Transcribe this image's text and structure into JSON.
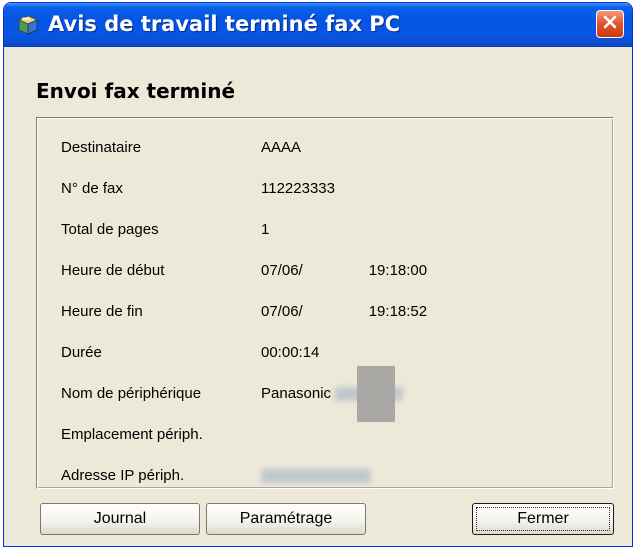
{
  "window": {
    "title": "Avis de travail terminé fax PC",
    "icon": "fax-app-icon",
    "close_icon": "close-icon"
  },
  "heading": "Envoi fax terminé",
  "details": [
    {
      "label": "Destinataire",
      "value": "AAAA"
    },
    {
      "label": "N° de fax",
      "value": "112223333"
    },
    {
      "label": "Total de pages",
      "value": "1"
    },
    {
      "label": "Heure de début",
      "value_prefix": "07/06/",
      "value_suffix": "19:18:00"
    },
    {
      "label": "Heure de fin",
      "value_prefix": "07/06/",
      "value_suffix": "19:18:52"
    },
    {
      "label": "Durée",
      "value": "00:00:14"
    },
    {
      "label": "Nom de périphérique",
      "value": "Panasonic"
    },
    {
      "label": "Emplacement périph.",
      "value": ""
    },
    {
      "label": "Adresse IP périph.",
      "value": ""
    }
  ],
  "buttons": {
    "journal": "Journal",
    "parametrage": "Paramétrage",
    "fermer": "Fermer"
  },
  "colors": {
    "titlebar": "#0554e3",
    "close_button": "#e2542c",
    "dialog_background": "#ece9d8"
  }
}
